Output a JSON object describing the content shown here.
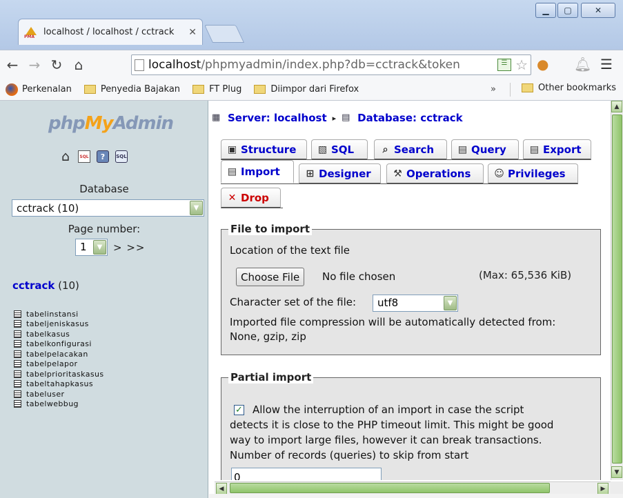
{
  "browser": {
    "tab_title": "localhost / localhost / cctrack",
    "favicon_text": "PMA",
    "url_host": "localhost",
    "url_rest": "/phpmyadmin/index.php?db=cctrack&token",
    "bookmarks": [
      "Perkenalan",
      "Penyedia Bajakan",
      "FT Plug",
      "Diimpor dari Firefox"
    ],
    "bookmarks_more": "»",
    "other_bookmarks": "Other bookmarks"
  },
  "nav": {
    "logo_php": "php",
    "logo_my": "My",
    "logo_admin": "Admin",
    "database_label": "Database",
    "database_selected": "cctrack (10)",
    "page_number_label": "Page number:",
    "page_selected": "1",
    "page_nav": "> >>",
    "db_name": "cctrack",
    "db_count": " (10)",
    "tables": [
      "tabelinstansi",
      "tabeljeniskasus",
      "tabelkasus",
      "tabelkonfigurasi",
      "tabelpelacakan",
      "tabelpelapor",
      "tabelprioritaskasus",
      "tabeltahapkasus",
      "tabeluser",
      "tabelwebbug"
    ]
  },
  "breadcrumb": {
    "server": "Server: localhost",
    "separator": "▸",
    "database": "Database: cctrack"
  },
  "tabs": {
    "structure": "Structure",
    "sql": "SQL",
    "search": "Search",
    "query": "Query",
    "export": "Export",
    "import": "Import",
    "designer": "Designer",
    "operations": "Operations",
    "privileges": "Privileges",
    "drop": "Drop"
  },
  "file_import": {
    "legend": "File to import",
    "location_label": "Location of the text file",
    "choose_button": "Choose File",
    "no_file": "No file chosen",
    "max_size": "(Max: 65,536 KiB)",
    "charset_label": "Character set of the file:",
    "charset_value": "utf8",
    "compression_line1": "Imported file compression will be automatically detected from:",
    "compression_line2": "None, gzip, zip"
  },
  "partial_import": {
    "legend": "Partial import",
    "allow_line1": "Allow the interruption of an import in case the script",
    "allow_line2": "detects it is close to the PHP timeout limit. This might be good",
    "allow_line3": "way to import large files, however it can break transactions.",
    "skip_label": "Number of records (queries) to skip from start",
    "skip_value": "0"
  }
}
